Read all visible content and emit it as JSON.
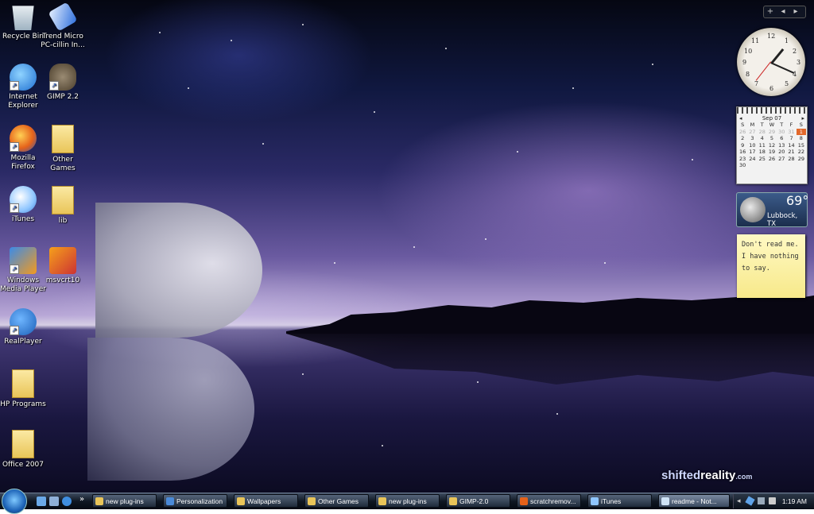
{
  "desktop_icons": [
    {
      "label": "Recycle Bin",
      "icon": "recycle-bin-icon"
    },
    {
      "label": "Trend Micro PC-cillin In...",
      "icon": "trend-micro-icon"
    },
    {
      "label": "Internet Explorer",
      "icon": "internet-explorer-icon"
    },
    {
      "label": "GIMP 2.2",
      "icon": "gimp-icon"
    },
    {
      "label": "Mozilla Firefox",
      "icon": "firefox-icon"
    },
    {
      "label": "Other Games",
      "icon": "folder-icon"
    },
    {
      "label": "iTunes",
      "icon": "itunes-icon"
    },
    {
      "label": "lib",
      "icon": "folder-icon"
    },
    {
      "label": "Windows Media Player",
      "icon": "windows-media-player-icon"
    },
    {
      "label": "msvcrt10",
      "icon": "archive-icon"
    },
    {
      "label": "RealPlayer",
      "icon": "realplayer-icon"
    },
    {
      "label": "HP Programs",
      "icon": "folder-icon"
    },
    {
      "label": "Office 2007",
      "icon": "folder-icon"
    }
  ],
  "sidebar": {
    "controls": {
      "add": "+",
      "prev": "◂",
      "next": "▸"
    },
    "clock": {
      "numbers": [
        "12",
        "1",
        "2",
        "3",
        "4",
        "5",
        "6",
        "7",
        "8",
        "9",
        "10",
        "11"
      ],
      "hour": 1,
      "minute": 19
    },
    "calendar": {
      "month_label": "Sep 07",
      "prev": "◂",
      "next": "▸",
      "weekdays": [
        "S",
        "M",
        "T",
        "W",
        "T",
        "F",
        "S"
      ],
      "weeks": [
        [
          "26",
          "27",
          "28",
          "29",
          "30",
          "31",
          "1"
        ],
        [
          "2",
          "3",
          "4",
          "5",
          "6",
          "7",
          "8"
        ],
        [
          "9",
          "10",
          "11",
          "12",
          "13",
          "14",
          "15"
        ],
        [
          "16",
          "17",
          "18",
          "19",
          "20",
          "21",
          "22"
        ],
        [
          "23",
          "24",
          "25",
          "26",
          "27",
          "28",
          "29"
        ],
        [
          "30",
          "",
          "",
          "",
          "",
          "",
          ""
        ]
      ],
      "today": "1"
    },
    "weather": {
      "temperature": "69°",
      "city": "Lubbock, TX"
    },
    "note": {
      "text": "Don't read me.  I have nothing to say."
    }
  },
  "watermark": {
    "part1": "shifted",
    "part2": "reality",
    "part3": ".com"
  },
  "taskbar": {
    "quick_launch_more": "»",
    "tasks": [
      {
        "label": "new plug-ins",
        "icon": "folder-icon",
        "color": "#e9c559"
      },
      {
        "label": "Personalization",
        "icon": "personalization-icon",
        "color": "#4a8ad8"
      },
      {
        "label": "Wallpapers",
        "icon": "folder-icon",
        "color": "#e9c559"
      },
      {
        "label": "Other Games",
        "icon": "folder-icon",
        "color": "#e9c559"
      },
      {
        "label": "new plug-ins",
        "icon": "folder-icon",
        "color": "#e9c559"
      },
      {
        "label": "GIMP-2.0",
        "icon": "folder-icon",
        "color": "#e9c559"
      },
      {
        "label": "scratchremov...",
        "icon": "firefox-icon",
        "color": "#e5621a"
      },
      {
        "label": "iTunes",
        "icon": "itunes-icon",
        "color": "#8fc6ff"
      },
      {
        "label": "readme - Not...",
        "icon": "notepad-icon",
        "color": "#cfe3f5"
      }
    ],
    "clock": "1:19 AM"
  }
}
